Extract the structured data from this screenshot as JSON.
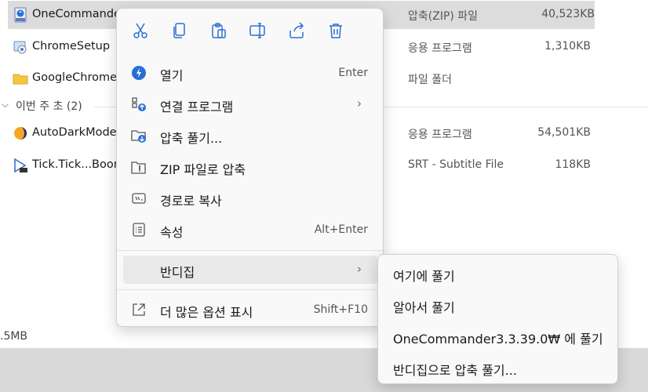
{
  "files": [
    {
      "name": "OneCommander",
      "type": "압축(ZIP) 파일",
      "size": "40,523KB",
      "icon": "zip-icon"
    },
    {
      "name": "ChromeSetup",
      "type": "응용 프로그램",
      "size": "1,310KB",
      "icon": "installer-icon"
    },
    {
      "name": "GoogleChromeP",
      "type": "파일 폴더",
      "size": "",
      "icon": "folder-icon"
    }
  ],
  "group": {
    "label": "이번 주 초 (2)",
    "chevron": "chevron-down-icon"
  },
  "files_week": [
    {
      "name": "AutoDarkMode>",
      "type": "응용 프로그램",
      "size": "54,501KB",
      "icon": "auto-dark-icon"
    },
    {
      "name": "Tick.Tick...Boom",
      "type": "SRT - Subtitle File",
      "size": "118KB",
      "icon": "srt-file-icon"
    }
  ],
  "status_bar": {
    "size": ".5MB"
  },
  "context_menu": {
    "toolbar": [
      "cut-icon",
      "copy-icon",
      "paste-icon",
      "rename-icon",
      "share-icon",
      "delete-icon"
    ],
    "items": [
      {
        "label": "열기",
        "shortcut": "Enter",
        "icon": "open-icon",
        "submenu": false
      },
      {
        "label": "연결 프로그램",
        "shortcut": "",
        "icon": "open-with-icon",
        "submenu": true
      },
      {
        "label": "압축 풀기...",
        "shortcut": "",
        "icon": "extract-icon",
        "submenu": false
      },
      {
        "label": "ZIP 파일로 압축",
        "shortcut": "",
        "icon": "zip-compress-icon",
        "submenu": false
      },
      {
        "label": "경로로 복사",
        "shortcut": "",
        "icon": "copy-path-icon",
        "submenu": false
      },
      {
        "label": "속성",
        "shortcut": "Alt+Enter",
        "icon": "properties-icon",
        "submenu": false
      },
      {
        "label": "반디집",
        "shortcut": "",
        "icon": "",
        "submenu": true
      },
      {
        "label": "더 많은 옵션 표시",
        "shortcut": "Shift+F10",
        "icon": "more-options-icon",
        "submenu": false
      }
    ]
  },
  "submenu": {
    "items": [
      "여기에 풀기",
      "알아서 풀기",
      "OneCommander3.3.39.0₩ 에 풀기",
      "반디집으로 압축 풀기..."
    ]
  },
  "colors": {
    "accent": "#2a6fd6",
    "selected_row": "#dcdcdc",
    "menu_bg": "#f9f9f9"
  }
}
